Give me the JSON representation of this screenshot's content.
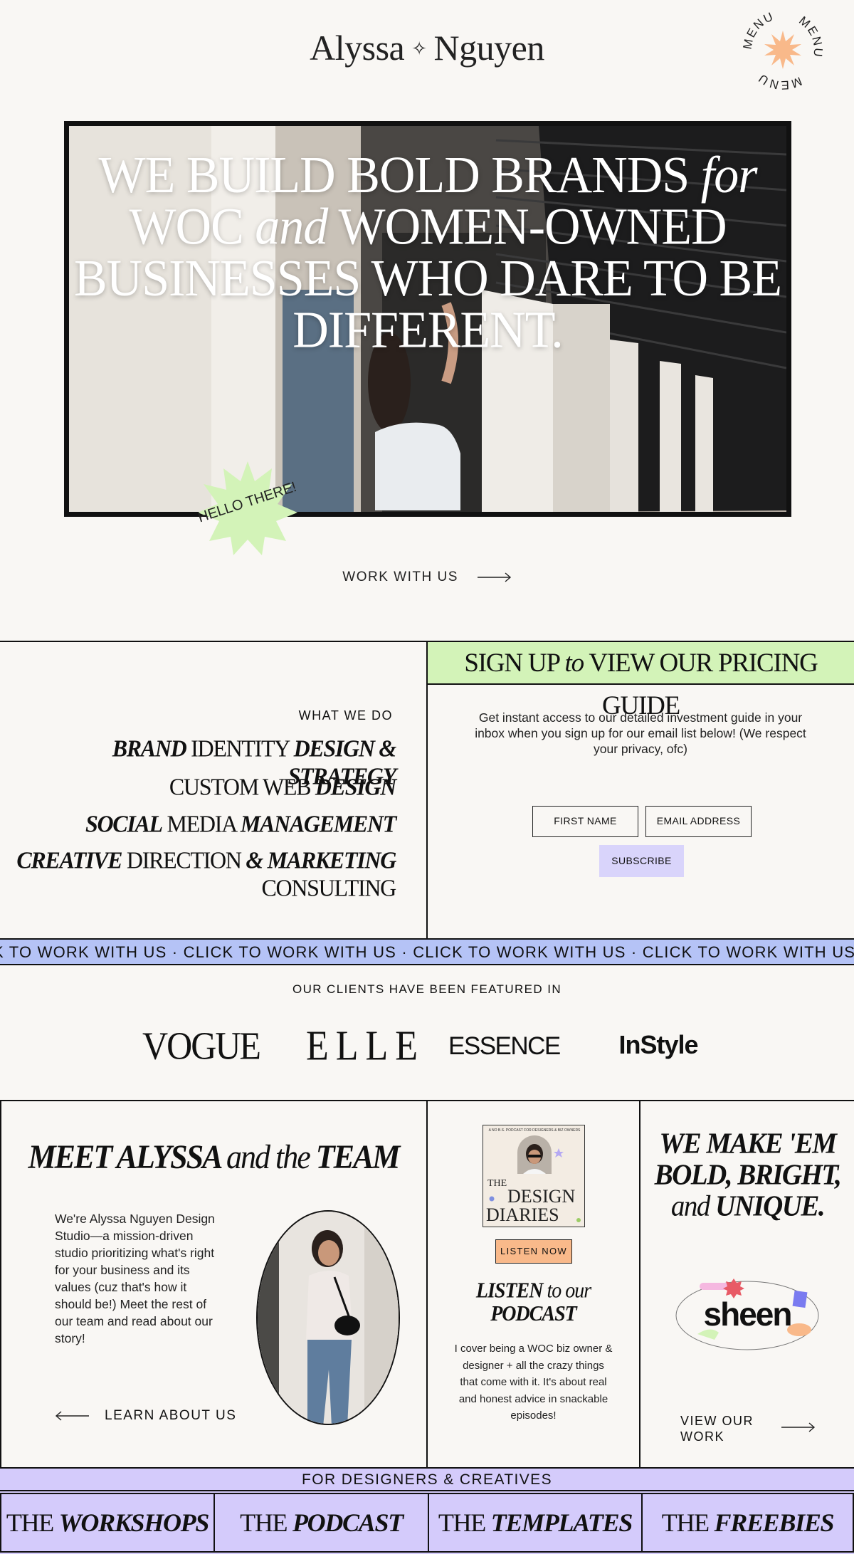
{
  "header": {
    "logo_first": "Alyssa",
    "logo_star": "✧",
    "logo_last": "Nguyen",
    "menu_label": "MENU",
    "menu_color": "#f9b98a"
  },
  "hero": {
    "line1_a": "WE BUILD BOLD BRANDS",
    "line1_b": "for",
    "line2_a": "WOC",
    "line2_b": "and",
    "line2_c": "WOMEN-OWNED",
    "line3": "BUSINESSES WHO DARE TO BE",
    "line4": "DIFFERENT.",
    "sticker": "HELLO THERE!",
    "sticker_color": "#d3f3b8"
  },
  "cta": {
    "work_with_us": "WORK WITH US"
  },
  "services": {
    "title": "WHAT WE DO",
    "items": [
      {
        "a": "BRAND",
        "b": "IDENTITY",
        "c": "DESIGN & STRATEGY",
        "d": ""
      },
      {
        "a": "",
        "b": "CUSTOM WEB",
        "c": "DESIGN",
        "d": ""
      },
      {
        "a": "SOCIAL",
        "b": "MEDIA",
        "c": "MANAGEMENT",
        "d": ""
      },
      {
        "a": "CREATIVE",
        "b": "DIRECTION",
        "c": "& MARKETING",
        "d": "CONSULTING"
      }
    ]
  },
  "signup": {
    "head_a": "SIGN UP",
    "head_b": "to",
    "head_c": "VIEW OUR PRICING GUIDE",
    "description": "Get instant access to our detailed investment guide in your inbox when you sign up for our email list below! (We respect your privacy, ofc)",
    "first_name_placeholder": "FIRST NAME",
    "email_placeholder": "EMAIL ADDRESS",
    "subscribe_label": "SUBSCRIBE"
  },
  "marquee": {
    "text": "K TO WORK WITH US · CLICK TO WORK WITH US · CLICK TO WORK WITH US · CLICK TO WORK WITH US · CLICK TO WORK WITH US · CLIC"
  },
  "featured": {
    "title": "OUR CLIENTS HAVE BEEN FEATURED IN",
    "brands": [
      "VOGUE",
      "ELLE",
      "ESSENCE",
      "InStyle"
    ]
  },
  "meet": {
    "title_a": "MEET ALYSSA",
    "title_b": "and the",
    "title_c": "TEAM",
    "body": "We're Alyssa Nguyen Design Studio—a mission-driven studio prioritizing what's right for your business and its values (cuz that's how it should be!) Meet the rest of our team and read about our story!",
    "learn_label": "LEARN ABOUT US"
  },
  "podcast": {
    "cover_top": "A NO B.S. PODCAST FOR DESIGNERS & BIZ OWNERS",
    "cover_the": "THE",
    "cover_design": "DESIGN",
    "cover_diaries": "DIARIES",
    "listen_label": "LISTEN NOW",
    "title_a": "LISTEN",
    "title_b": "to our",
    "title_c": "PODCAST",
    "description": "I cover being a WOC biz owner & designer + all the crazy things that come with it. It's about real and honest advice in snackable episodes!"
  },
  "work": {
    "title_a": "WE MAKE 'EM BOLD, BRIGHT,",
    "title_b": "and",
    "title_c": "UNIQUE.",
    "sample_logo": "sheen",
    "view_label": "VIEW OUR WORK"
  },
  "resources": {
    "banner": "FOR DESIGNERS & CREATIVES",
    "items": [
      {
        "the": "THE",
        "name": "WORKSHOPS"
      },
      {
        "the": "THE",
        "name": "PODCAST"
      },
      {
        "the": "THE",
        "name": "TEMPLATES"
      },
      {
        "the": "THE",
        "name": "FREEBIES"
      }
    ],
    "color": "#d4cbfb"
  }
}
